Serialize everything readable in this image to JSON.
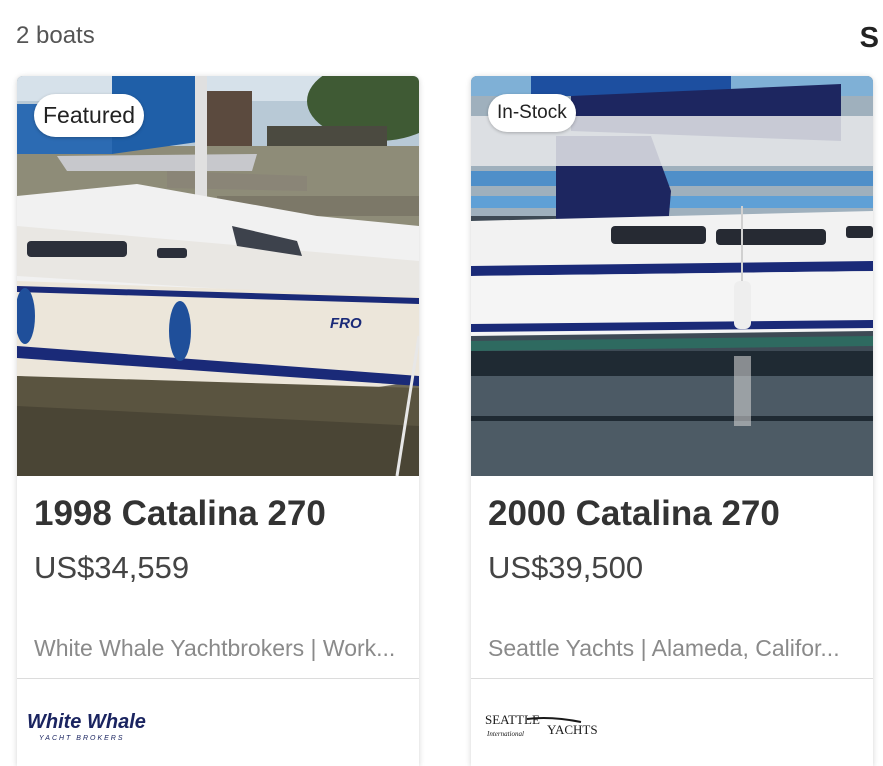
{
  "results": {
    "count_label": "2 boats",
    "sort_label": "S"
  },
  "listings": [
    {
      "badge": "Featured",
      "title": "1998 Catalina 270",
      "price": "US$34,559",
      "dealer": "White Whale Yachtbrokers | Work...",
      "hull_name": "FRO",
      "logo": {
        "line1": "White Whale",
        "line2": "YACHT BROKERS"
      },
      "colors": {
        "hull_stripe": "#1a2a78",
        "cover": "#1f5fa8"
      }
    },
    {
      "badge": "In-Stock",
      "title": "2000 Catalina 270",
      "price": "US$39,500",
      "dealer": "Seattle Yachts | Alameda, Califor...",
      "logo": {
        "line1": "SEATTLE",
        "line2": "International",
        "line3": "YACHTS"
      },
      "colors": {
        "hull_stripe": "#1a2a78",
        "cover": "#1d2660"
      }
    }
  ]
}
